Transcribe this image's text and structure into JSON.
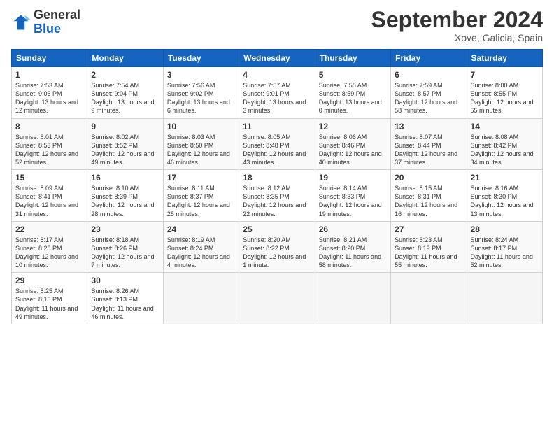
{
  "header": {
    "logo_general": "General",
    "logo_blue": "Blue",
    "month_title": "September 2024",
    "location": "Xove, Galicia, Spain"
  },
  "weekdays": [
    "Sunday",
    "Monday",
    "Tuesday",
    "Wednesday",
    "Thursday",
    "Friday",
    "Saturday"
  ],
  "weeks": [
    [
      {
        "day": "1",
        "sunrise": "Sunrise: 7:53 AM",
        "sunset": "Sunset: 9:06 PM",
        "daylight": "Daylight: 13 hours and 12 minutes."
      },
      {
        "day": "2",
        "sunrise": "Sunrise: 7:54 AM",
        "sunset": "Sunset: 9:04 PM",
        "daylight": "Daylight: 13 hours and 9 minutes."
      },
      {
        "day": "3",
        "sunrise": "Sunrise: 7:56 AM",
        "sunset": "Sunset: 9:02 PM",
        "daylight": "Daylight: 13 hours and 6 minutes."
      },
      {
        "day": "4",
        "sunrise": "Sunrise: 7:57 AM",
        "sunset": "Sunset: 9:01 PM",
        "daylight": "Daylight: 13 hours and 3 minutes."
      },
      {
        "day": "5",
        "sunrise": "Sunrise: 7:58 AM",
        "sunset": "Sunset: 8:59 PM",
        "daylight": "Daylight: 13 hours and 0 minutes."
      },
      {
        "day": "6",
        "sunrise": "Sunrise: 7:59 AM",
        "sunset": "Sunset: 8:57 PM",
        "daylight": "Daylight: 12 hours and 58 minutes."
      },
      {
        "day": "7",
        "sunrise": "Sunrise: 8:00 AM",
        "sunset": "Sunset: 8:55 PM",
        "daylight": "Daylight: 12 hours and 55 minutes."
      }
    ],
    [
      {
        "day": "8",
        "sunrise": "Sunrise: 8:01 AM",
        "sunset": "Sunset: 8:53 PM",
        "daylight": "Daylight: 12 hours and 52 minutes."
      },
      {
        "day": "9",
        "sunrise": "Sunrise: 8:02 AM",
        "sunset": "Sunset: 8:52 PM",
        "daylight": "Daylight: 12 hours and 49 minutes."
      },
      {
        "day": "10",
        "sunrise": "Sunrise: 8:03 AM",
        "sunset": "Sunset: 8:50 PM",
        "daylight": "Daylight: 12 hours and 46 minutes."
      },
      {
        "day": "11",
        "sunrise": "Sunrise: 8:05 AM",
        "sunset": "Sunset: 8:48 PM",
        "daylight": "Daylight: 12 hours and 43 minutes."
      },
      {
        "day": "12",
        "sunrise": "Sunrise: 8:06 AM",
        "sunset": "Sunset: 8:46 PM",
        "daylight": "Daylight: 12 hours and 40 minutes."
      },
      {
        "day": "13",
        "sunrise": "Sunrise: 8:07 AM",
        "sunset": "Sunset: 8:44 PM",
        "daylight": "Daylight: 12 hours and 37 minutes."
      },
      {
        "day": "14",
        "sunrise": "Sunrise: 8:08 AM",
        "sunset": "Sunset: 8:42 PM",
        "daylight": "Daylight: 12 hours and 34 minutes."
      }
    ],
    [
      {
        "day": "15",
        "sunrise": "Sunrise: 8:09 AM",
        "sunset": "Sunset: 8:41 PM",
        "daylight": "Daylight: 12 hours and 31 minutes."
      },
      {
        "day": "16",
        "sunrise": "Sunrise: 8:10 AM",
        "sunset": "Sunset: 8:39 PM",
        "daylight": "Daylight: 12 hours and 28 minutes."
      },
      {
        "day": "17",
        "sunrise": "Sunrise: 8:11 AM",
        "sunset": "Sunset: 8:37 PM",
        "daylight": "Daylight: 12 hours and 25 minutes."
      },
      {
        "day": "18",
        "sunrise": "Sunrise: 8:12 AM",
        "sunset": "Sunset: 8:35 PM",
        "daylight": "Daylight: 12 hours and 22 minutes."
      },
      {
        "day": "19",
        "sunrise": "Sunrise: 8:14 AM",
        "sunset": "Sunset: 8:33 PM",
        "daylight": "Daylight: 12 hours and 19 minutes."
      },
      {
        "day": "20",
        "sunrise": "Sunrise: 8:15 AM",
        "sunset": "Sunset: 8:31 PM",
        "daylight": "Daylight: 12 hours and 16 minutes."
      },
      {
        "day": "21",
        "sunrise": "Sunrise: 8:16 AM",
        "sunset": "Sunset: 8:30 PM",
        "daylight": "Daylight: 12 hours and 13 minutes."
      }
    ],
    [
      {
        "day": "22",
        "sunrise": "Sunrise: 8:17 AM",
        "sunset": "Sunset: 8:28 PM",
        "daylight": "Daylight: 12 hours and 10 minutes."
      },
      {
        "day": "23",
        "sunrise": "Sunrise: 8:18 AM",
        "sunset": "Sunset: 8:26 PM",
        "daylight": "Daylight: 12 hours and 7 minutes."
      },
      {
        "day": "24",
        "sunrise": "Sunrise: 8:19 AM",
        "sunset": "Sunset: 8:24 PM",
        "daylight": "Daylight: 12 hours and 4 minutes."
      },
      {
        "day": "25",
        "sunrise": "Sunrise: 8:20 AM",
        "sunset": "Sunset: 8:22 PM",
        "daylight": "Daylight: 12 hours and 1 minute."
      },
      {
        "day": "26",
        "sunrise": "Sunrise: 8:21 AM",
        "sunset": "Sunset: 8:20 PM",
        "daylight": "Daylight: 11 hours and 58 minutes."
      },
      {
        "day": "27",
        "sunrise": "Sunrise: 8:23 AM",
        "sunset": "Sunset: 8:19 PM",
        "daylight": "Daylight: 11 hours and 55 minutes."
      },
      {
        "day": "28",
        "sunrise": "Sunrise: 8:24 AM",
        "sunset": "Sunset: 8:17 PM",
        "daylight": "Daylight: 11 hours and 52 minutes."
      }
    ],
    [
      {
        "day": "29",
        "sunrise": "Sunrise: 8:25 AM",
        "sunset": "Sunset: 8:15 PM",
        "daylight": "Daylight: 11 hours and 49 minutes."
      },
      {
        "day": "30",
        "sunrise": "Sunrise: 8:26 AM",
        "sunset": "Sunset: 8:13 PM",
        "daylight": "Daylight: 11 hours and 46 minutes."
      },
      null,
      null,
      null,
      null,
      null
    ]
  ]
}
